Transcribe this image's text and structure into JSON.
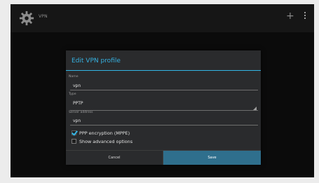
{
  "actionbar": {
    "app_title": "VPN",
    "icons": [
      "settings-gear-icon",
      "plus-icon",
      "overflow-menu-icon"
    ],
    "plus_glyph": "+"
  },
  "dialog": {
    "title": "Edit VPN profile",
    "fields": {
      "name": {
        "label": "Name",
        "value": "vpn"
      },
      "type": {
        "label": "Type",
        "value": "PPTP"
      },
      "server": {
        "label": "Server address",
        "value": "vpn"
      }
    },
    "checkboxes": {
      "ppp_encryption": {
        "label": "PPP encryption (MPPE)",
        "checked": true
      },
      "show_advanced": {
        "label": "Show advanced options",
        "checked": false
      }
    },
    "buttons": {
      "cancel": "Cancel",
      "save": "Save"
    }
  },
  "colors": {
    "accent": "#33b5e5",
    "title_text": "#36b2e2",
    "dialog_bg": "#2a2b2d",
    "save_button_bg": "#2f6f8d",
    "screen_bg": "#0b0b0b"
  }
}
